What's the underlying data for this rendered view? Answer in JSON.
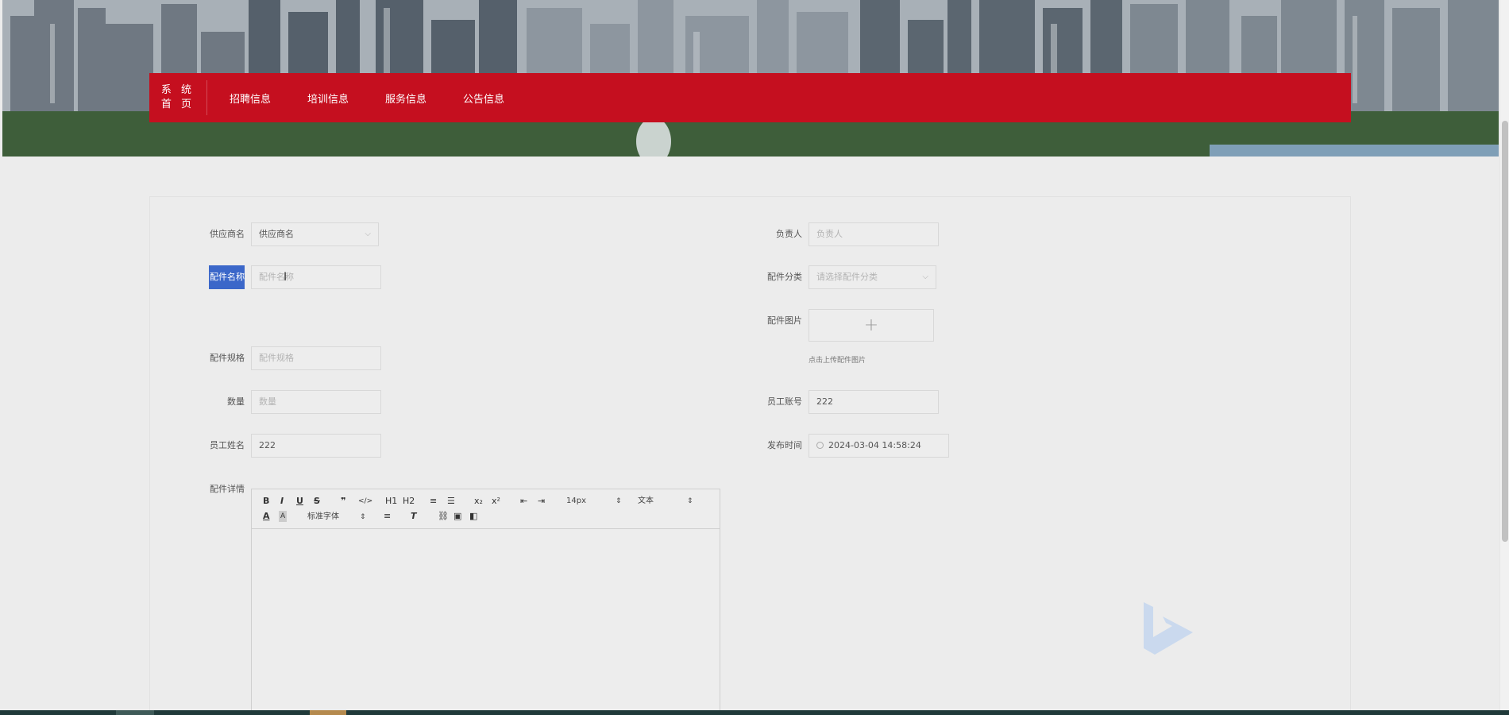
{
  "nav": {
    "home_line1": "系 统",
    "home_line2": "首 页",
    "items": [
      "招聘信息",
      "培训信息",
      "服务信息",
      "公告信息"
    ]
  },
  "form": {
    "supplier": {
      "label": "供应商名",
      "value": "供应商名"
    },
    "manager": {
      "label": "负责人",
      "placeholder": "负责人"
    },
    "part_name": {
      "label": "配件名称",
      "placeholder": "配件名称"
    },
    "part_category": {
      "label": "配件分类",
      "placeholder": "请选择配件分类"
    },
    "part_image": {
      "label": "配件图片",
      "upload_tip": "点击上传配件图片",
      "plus": "+"
    },
    "part_spec": {
      "label": "配件规格",
      "placeholder": "配件规格"
    },
    "quantity": {
      "label": "数量",
      "placeholder": "数量"
    },
    "employee_account": {
      "label": "员工账号",
      "value": "222"
    },
    "employee_name": {
      "label": "员工姓名",
      "value": "222"
    },
    "publish_time": {
      "label": "发布时间",
      "value": "2024-03-04 14:58:24"
    },
    "part_detail": {
      "label": "配件详情"
    }
  },
  "editor": {
    "row1": [
      "B",
      "I",
      "U",
      "S",
      "❞",
      "</>",
      "H1",
      "H2",
      "≡",
      "☰",
      "x₂",
      "x²",
      "⇤",
      "⇥"
    ],
    "font_size": "14px",
    "text_style": "文本",
    "font_family": "标准字体"
  },
  "colors": {
    "nav_red": "#c50f1f",
    "label_highlight": "#3b67c9",
    "page_bg": "#ececec"
  },
  "icons": [
    "chevron-down-icon",
    "clock-icon",
    "plus-icon",
    "text-cursor-icon",
    "watermark-logo-icon"
  ]
}
